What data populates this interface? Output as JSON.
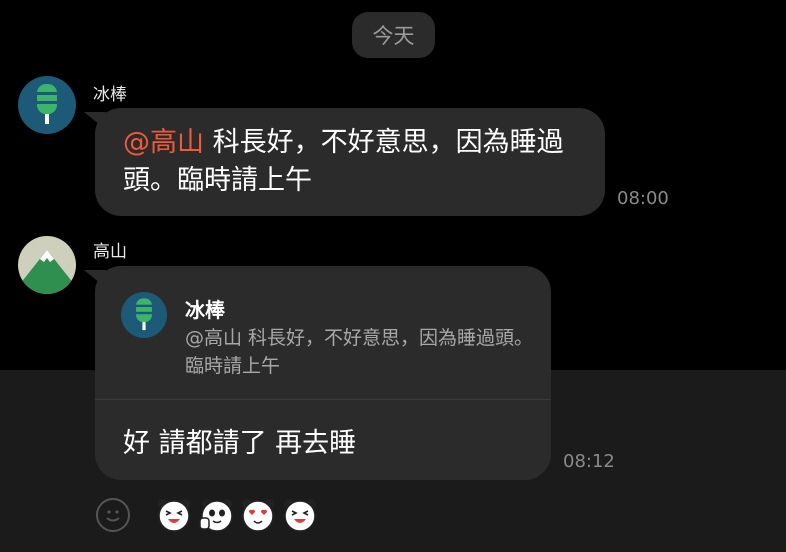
{
  "date_label": "今天",
  "messages": [
    {
      "sender": "冰棒",
      "mention": "@高山",
      "text": " 科長好，不好意思，因為睡過頭。臨時請上午",
      "time": "08:00"
    },
    {
      "sender": "高山",
      "quote": {
        "sender": "冰棒",
        "text": "@高山 科長好，不好意思，因為睡過頭。臨時請上午"
      },
      "text": "好 請都請了  再去睡",
      "time": "08:12"
    }
  ],
  "input_bar": {
    "emoji_icon": "smiley-icon",
    "stickers": [
      "panda-laugh-sticker",
      "panda-thumbs-up-sticker",
      "panda-heart-eyes-sticker",
      "panda-laugh-sticker"
    ]
  },
  "colors": {
    "background": "#000000",
    "bubble": "#2b2b2b",
    "mention": "#ef5a3c",
    "timestamp": "#8a8a8a"
  }
}
